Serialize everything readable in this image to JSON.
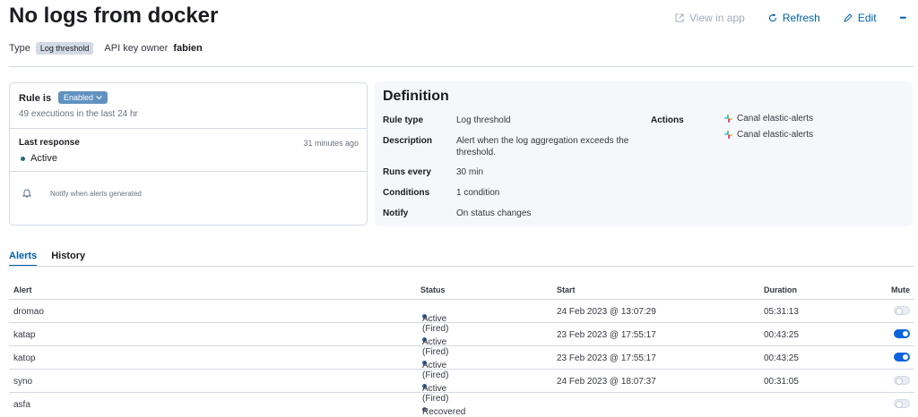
{
  "header": {
    "title": "No logs from docker",
    "actions": {
      "view": "View in app",
      "refresh": "Refresh",
      "edit": "Edit",
      "more": "•••"
    }
  },
  "meta": {
    "type_label": "Type",
    "type_value": "Log threshold",
    "owner_label": "API key owner",
    "owner_value": "fabien"
  },
  "status_card": {
    "rule_is": "Rule is",
    "enabled": "Enabled",
    "executions": "49 executions in the last 24 hr",
    "last_response_label": "Last response",
    "last_response_time": "31 minutes ago",
    "last_response_value": "Active",
    "notify": "Notify when alerts generated"
  },
  "definition": {
    "title": "Definition",
    "rule_type_label": "Rule type",
    "rule_type": "Log threshold",
    "description_label": "Description",
    "description_line1": "Alert when the log aggregation exceeds the",
    "description_line2": "threshold.",
    "runs_every_label": "Runs every",
    "runs_every": "30 min",
    "conditions_label": "Conditions",
    "conditions": "1 condition",
    "notify_label": "Notify",
    "notify": "On status changes",
    "actions_label": "Actions",
    "actions": [
      "Canal elastic-alerts",
      "Canal elastic-alerts"
    ]
  },
  "tabs": [
    "Alerts",
    "History"
  ],
  "table": {
    "headers": {
      "alert": "Alert",
      "status": "Status",
      "start": "Start",
      "duration": "Duration",
      "mute": "Mute"
    },
    "rows": [
      {
        "alert": "dromao",
        "status": "Active (Fired)",
        "start": "24 Feb 2023 @ 13:07:29",
        "duration": "05:31:13",
        "muted": false
      },
      {
        "alert": "katap",
        "status": "Active (Fired)",
        "start": "23 Feb 2023 @ 17:55:17",
        "duration": "00:43:25",
        "muted": true
      },
      {
        "alert": "katop",
        "status": "Active (Fired)",
        "start": "23 Feb 2023 @ 17:55:17",
        "duration": "00:43:25",
        "muted": true
      },
      {
        "alert": "syno",
        "status": "Active (Fired)",
        "start": "24 Feb 2023 @ 18:07:37",
        "duration": "00:31:05",
        "muted": false
      },
      {
        "alert": "asfa",
        "status": "Recovered",
        "start": "",
        "duration": "",
        "muted": false
      }
    ]
  },
  "colors": {
    "active": "#2f64a3",
    "recovered": "#69707d",
    "link": "#0061a6"
  }
}
